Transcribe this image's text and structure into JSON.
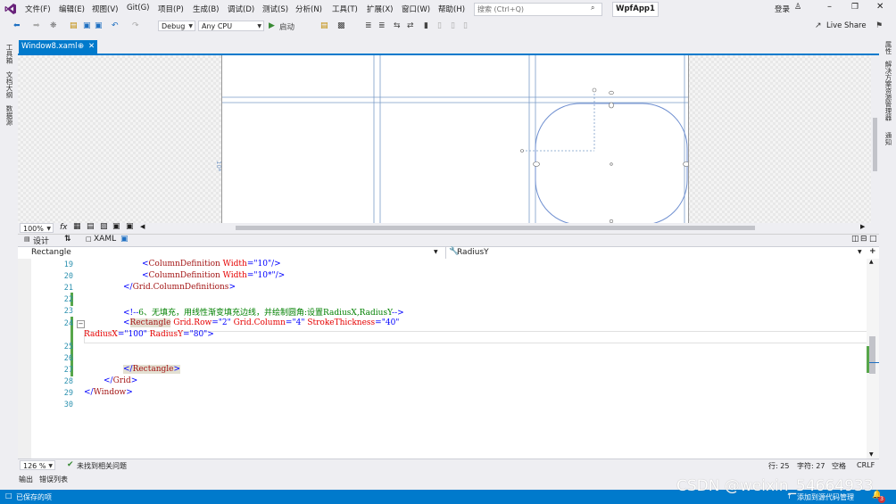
{
  "menu": [
    "文件(F)",
    "编辑(E)",
    "视图(V)",
    "Git(G)",
    "项目(P)",
    "生成(B)",
    "调试(D)",
    "测试(S)",
    "分析(N)",
    "工具(T)",
    "扩展(X)",
    "窗口(W)",
    "帮助(H)"
  ],
  "search_placeholder": "搜索 (Ctrl+Q)",
  "project_name": "WpfApp1",
  "login_label": "登录",
  "toolbar": {
    "config": "Debug",
    "platform": "Any CPU",
    "start_label": "启动",
    "live_share": "Live Share"
  },
  "left_rail": [
    "工具箱",
    "文档大纲",
    "数据源"
  ],
  "right_rail": [
    "属性",
    "解决方案资源管理器",
    "通知"
  ],
  "doc_tab": {
    "title": "Window8.xaml",
    "pin": "⊕",
    "close": "✕"
  },
  "designer": {
    "zoom": "100%",
    "fx": "fx",
    "margin_label": "10*"
  },
  "split": {
    "design_tab": "设计",
    "swap": "⇅",
    "xaml_tab": "XAML"
  },
  "nav": {
    "left": "Rectangle",
    "right": "RadiusY"
  },
  "code_lines": [
    {
      "n": "19",
      "parts": [
        {
          "c": "br",
          "t": "<"
        },
        {
          "c": "tag",
          "t": "ColumnDefinition"
        },
        {
          "c": "attr",
          "t": " Width"
        },
        {
          "c": "br",
          "t": "=\"10\"/>"
        }
      ]
    },
    {
      "n": "20",
      "parts": [
        {
          "c": "br",
          "t": "<"
        },
        {
          "c": "tag",
          "t": "ColumnDefinition"
        },
        {
          "c": "attr",
          "t": " Width"
        },
        {
          "c": "br",
          "t": "=\"10*\"/>"
        }
      ]
    },
    {
      "n": "21",
      "parts": [
        {
          "c": "br",
          "t": "</"
        },
        {
          "c": "tag",
          "t": "Grid.ColumnDefinitions"
        },
        {
          "c": "br",
          "t": ">"
        }
      ]
    },
    {
      "n": "22",
      "parts": []
    },
    {
      "n": "23",
      "parts": [
        {
          "c": "br",
          "t": "<!--"
        },
        {
          "c": "cm",
          "t": "6、无填充，用线性渐变填充边线，并绘制圆角:设置RadiusX,RadiusY"
        },
        {
          "c": "br",
          "t": "-->"
        }
      ]
    },
    {
      "n": "24",
      "parts": [
        {
          "c": "br",
          "t": "<"
        },
        {
          "c": "tag",
          "t": "Rectangle"
        },
        {
          "c": "attr",
          "t": " Grid.Row"
        },
        {
          "c": "br",
          "t": "=\"2\""
        },
        {
          "c": "attr",
          "t": " Grid.Column"
        },
        {
          "c": "br",
          "t": "=\"4\""
        },
        {
          "c": "attr",
          "t": " StrokeThickness"
        },
        {
          "c": "br",
          "t": "=\"40\""
        }
      ]
    },
    {
      "n": "",
      "parts": [
        {
          "c": "attr",
          "t": "RadiusX"
        },
        {
          "c": "br",
          "t": "=\"100\""
        },
        {
          "c": "attr",
          "t": " RadiusY"
        },
        {
          "c": "br",
          "t": "=\"80\">"
        }
      ]
    },
    {
      "n": "25",
      "parts": []
    },
    {
      "n": "26",
      "parts": []
    },
    {
      "n": "27",
      "parts": [
        {
          "c": "br",
          "t": "</"
        },
        {
          "c": "tag",
          "t": "Rectangle"
        },
        {
          "c": "br",
          "t": ">"
        }
      ]
    },
    {
      "n": "28",
      "parts": [
        {
          "c": "br",
          "t": "</"
        },
        {
          "c": "tag",
          "t": "Grid"
        },
        {
          "c": "br",
          "t": ">"
        }
      ]
    },
    {
      "n": "29",
      "parts": [
        {
          "c": "br",
          "t": "</"
        },
        {
          "c": "tag",
          "t": "Window"
        },
        {
          "c": "br",
          "t": ">"
        }
      ]
    },
    {
      "n": "30",
      "parts": []
    }
  ],
  "editor_status": {
    "zoom": "126 %",
    "issues": "未找到相关问题",
    "line": "行: 25",
    "char": "字符: 27",
    "ws": "空格",
    "eol": "CRLF"
  },
  "output_tabs": [
    "输出",
    "错误列表"
  ],
  "status": {
    "saved": "已保存的项",
    "source_control": "添加到源代码管理",
    "notif_count": "3"
  },
  "watermark": "CSDN @weixin_54664933",
  "colors": {
    "accent": "#007acc",
    "vs_purple": "#68217a"
  }
}
